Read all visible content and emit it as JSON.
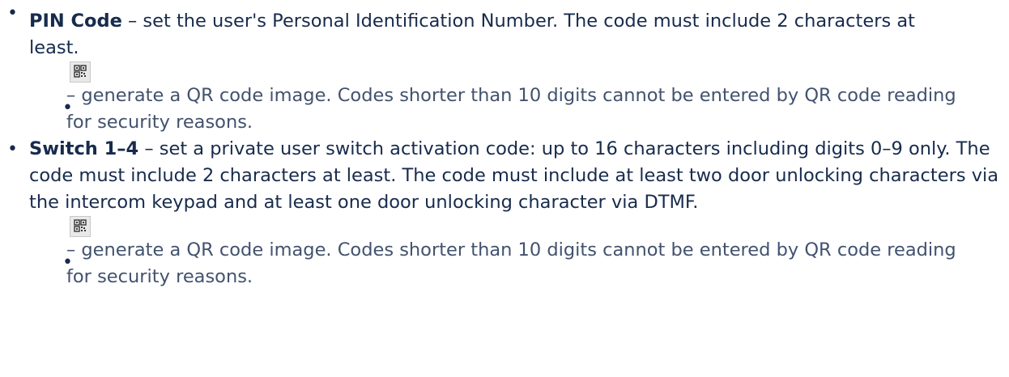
{
  "items": [
    {
      "term": "PIN Code",
      "description": " – set the user's Personal Identification Number. The code must include 2 characters at least.",
      "sub": {
        "icon": "qr-code-icon",
        "text": " – generate a QR code image. Codes shorter than 10 digits cannot be entered by QR code reading for security reasons."
      }
    },
    {
      "term": "Switch 1–4",
      "description": " – set a private user switch activation code: up to 16 characters including digits 0–9 only. The code must include 2 characters at least. The code must include at least two door unlocking characters via the intercom keypad and at least one door unlocking character via DTMF.",
      "sub": {
        "icon": "qr-code-icon",
        "text": " – generate a QR code image. Codes shorter than 10 digits cannot be entered by QR code reading for security reasons."
      }
    }
  ],
  "colors": {
    "text": "#172b4d",
    "subtext": "#42526e",
    "icon_bg": "#e9e9e9"
  }
}
